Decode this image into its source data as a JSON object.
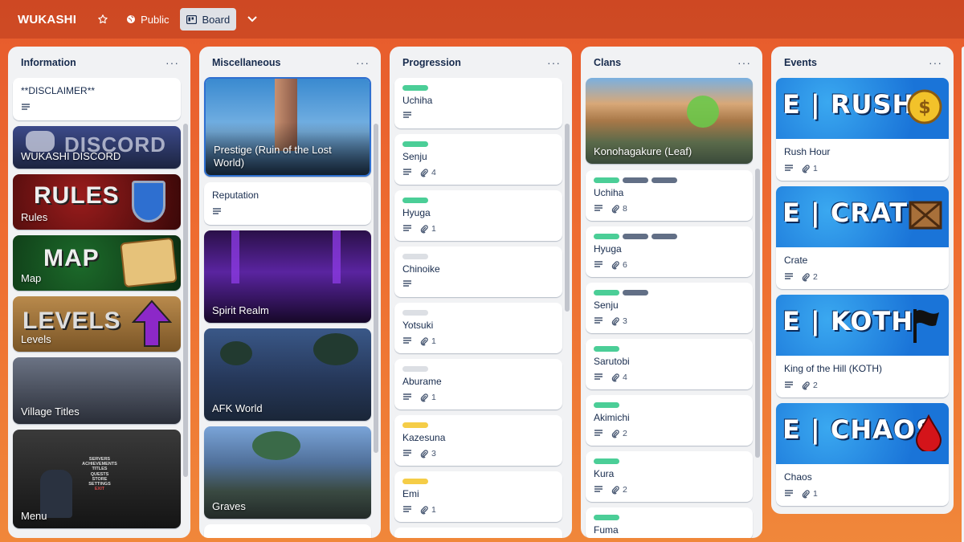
{
  "header": {
    "board_title": "WUKASHI",
    "visibility": "Public",
    "view": "Board"
  },
  "lists": {
    "information": {
      "title": "Information",
      "cards": [
        {
          "title": "**DISCLAIMER**"
        },
        {
          "title": "WUKASHI DISCORD",
          "cover_text": "DISCORD"
        },
        {
          "title": "Rules",
          "cover_text": "RULES"
        },
        {
          "title": "Map",
          "cover_text": "MAP"
        },
        {
          "title": "Levels",
          "cover_text": "LEVELS"
        },
        {
          "title": "Village Titles"
        },
        {
          "title": "Menu",
          "menu_lines": [
            "SERVERS",
            "ACHIEVEMENTS",
            "TITLES",
            "QUESTS",
            "STORE",
            "SETTINGS",
            "EXIT"
          ]
        }
      ]
    },
    "misc": {
      "title": "Miscellaneous",
      "cards": [
        {
          "title": "Prestige (Ruin of the Lost World)"
        },
        {
          "title": "Reputation"
        },
        {
          "title": "Spirit Realm"
        },
        {
          "title": "AFK World"
        },
        {
          "title": "Graves"
        }
      ]
    },
    "progression": {
      "title": "Progression",
      "cards": [
        {
          "title": "Uchiha",
          "attachments": ""
        },
        {
          "title": "Senju",
          "attachments": "4"
        },
        {
          "title": "Hyuga",
          "attachments": "1"
        },
        {
          "title": "Chinoike",
          "attachments": ""
        },
        {
          "title": "Yotsuki",
          "attachments": "1"
        },
        {
          "title": "Aburame",
          "attachments": "1"
        },
        {
          "title": "Kazesuna",
          "attachments": "3"
        },
        {
          "title": "Emi",
          "attachments": "1"
        }
      ]
    },
    "clans": {
      "title": "Clans",
      "cards": [
        {
          "title": "Konohagakure (Leaf)"
        },
        {
          "title": "Uchiha",
          "attachments": "8"
        },
        {
          "title": "Hyuga",
          "attachments": "6"
        },
        {
          "title": "Senju",
          "attachments": "3"
        },
        {
          "title": "Sarutobi",
          "attachments": "4"
        },
        {
          "title": "Akimichi",
          "attachments": "2"
        },
        {
          "title": "Kura",
          "attachments": "2"
        },
        {
          "title": "Fuma"
        }
      ]
    },
    "events": {
      "title": "Events",
      "cards": [
        {
          "title": "Rush Hour",
          "cover_text": "E | RUSH",
          "attachments": "1"
        },
        {
          "title": "Crate",
          "cover_text": "E | CRATE",
          "attachments": "2"
        },
        {
          "title": "King of the Hill (KOTH)",
          "cover_text": "E | KOTH",
          "attachments": "2"
        },
        {
          "title": "Chaos",
          "cover_text": "E | CHAOS",
          "attachments": "1"
        }
      ]
    }
  },
  "colors": {
    "label_green": "#4bce97",
    "label_gray": "#626f86",
    "label_light": "#dcdfe4",
    "label_yellow": "#f5cd47"
  },
  "icons": {
    "star": "star-icon",
    "globe": "globe-icon",
    "board": "board-icon",
    "chevron": "chevron-down-icon",
    "description": "description-icon",
    "attachment": "paperclip-icon",
    "more": "more-icon"
  }
}
